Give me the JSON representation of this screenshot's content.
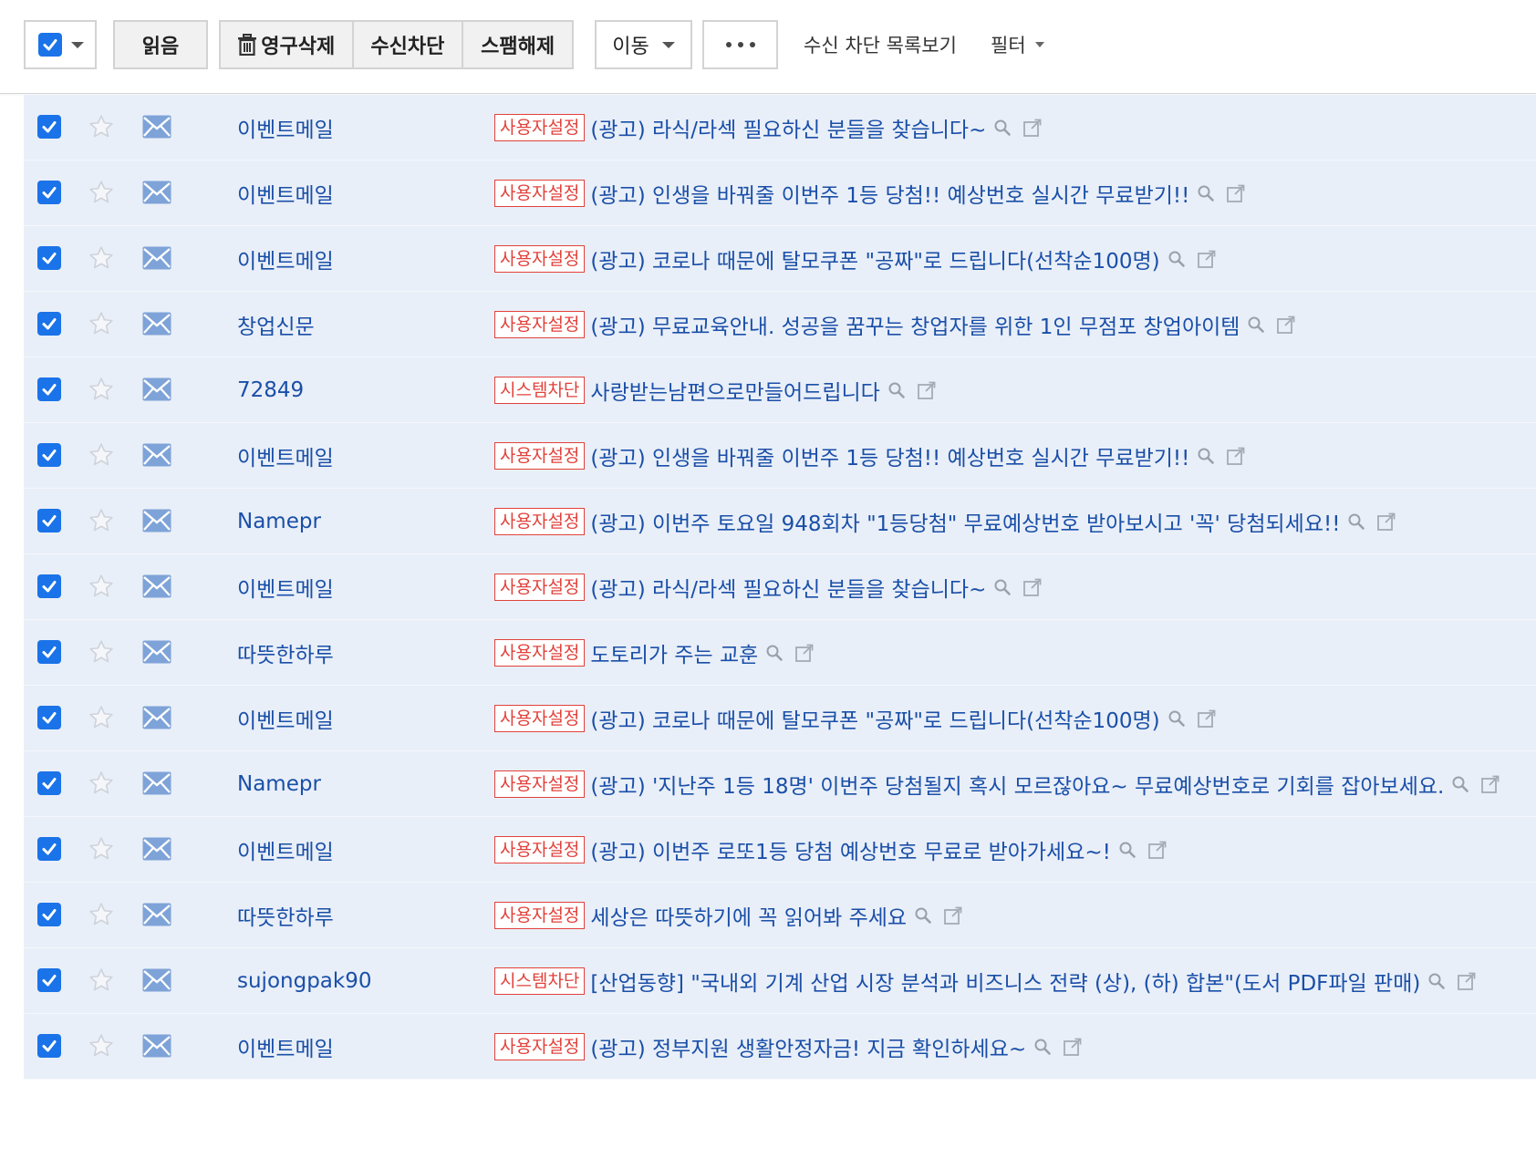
{
  "toolbar": {
    "read_label": "읽음",
    "delete_label": "영구삭제",
    "block_label": "수신차단",
    "unspam_label": "스팸해제",
    "move_label": "이동",
    "blocklist_label": "수신 차단 목록보기",
    "filter_label": "필터"
  },
  "colors": {
    "accent": "#1a73e8",
    "link": "#1a4fa8",
    "badge": "#e2413b",
    "row_bg": "#e9eff8"
  },
  "icons": [
    "checkbox-icon",
    "trash-icon",
    "star-icon",
    "mail-icon",
    "search-icon",
    "popup-icon"
  ],
  "rows": [
    {
      "sender": "이벤트메일",
      "badge": "사용자설정",
      "subject": "(광고) 라식/라섹 필요하신 분들을 찾습니다~"
    },
    {
      "sender": "이벤트메일",
      "badge": "사용자설정",
      "subject": "(광고) 인생을 바꿔줄 이번주 1등 당첨!! 예상번호 실시간 무료받기!!"
    },
    {
      "sender": "이벤트메일",
      "badge": "사용자설정",
      "subject": "(광고) 코로나 때문에 탈모쿠폰 \"공짜\"로 드립니다(선착순100명)"
    },
    {
      "sender": "창업신문",
      "badge": "사용자설정",
      "subject": "(광고) 무료교육안내. 성공을 꿈꾸는 창업자를 위한 1인 무점포 창업아이템"
    },
    {
      "sender": "72849",
      "badge": "시스템차단",
      "subject": "사랑받는남편으로만들어드립니다"
    },
    {
      "sender": "이벤트메일",
      "badge": "사용자설정",
      "subject": "(광고) 인생을 바꿔줄 이번주 1등 당첨!! 예상번호 실시간 무료받기!!"
    },
    {
      "sender": "Namepr",
      "badge": "사용자설정",
      "subject": "(광고) 이번주 토요일 948회차 \"1등당첨\" 무료예상번호 받아보시고 '꼭' 당첨되세요!!"
    },
    {
      "sender": "이벤트메일",
      "badge": "사용자설정",
      "subject": "(광고) 라식/라섹 필요하신 분들을 찾습니다~"
    },
    {
      "sender": "따뜻한하루",
      "badge": "사용자설정",
      "subject": "도토리가 주는 교훈"
    },
    {
      "sender": "이벤트메일",
      "badge": "사용자설정",
      "subject": "(광고) 코로나 때문에 탈모쿠폰 \"공짜\"로 드립니다(선착순100명)"
    },
    {
      "sender": "Namepr",
      "badge": "사용자설정",
      "subject": "(광고) '지난주 1등 18명' 이번주 당첨될지 혹시 모르잖아요~ 무료예상번호로 기회를 잡아보세요."
    },
    {
      "sender": "이벤트메일",
      "badge": "사용자설정",
      "subject": "(광고) 이번주 로또1등 당첨 예상번호 무료로 받아가세요~!"
    },
    {
      "sender": "따뜻한하루",
      "badge": "사용자설정",
      "subject": "세상은 따뜻하기에 꼭 읽어봐 주세요"
    },
    {
      "sender": "sujongpak90",
      "badge": "시스템차단",
      "subject": "[산업동향] \"국내외 기계 산업 시장 분석과 비즈니스 전략 (상), (하) 합본\"(도서 PDF파일 판매)"
    },
    {
      "sender": "이벤트메일",
      "badge": "사용자설정",
      "subject": "(광고) 정부지원 생활안정자금! 지금 확인하세요~"
    }
  ]
}
